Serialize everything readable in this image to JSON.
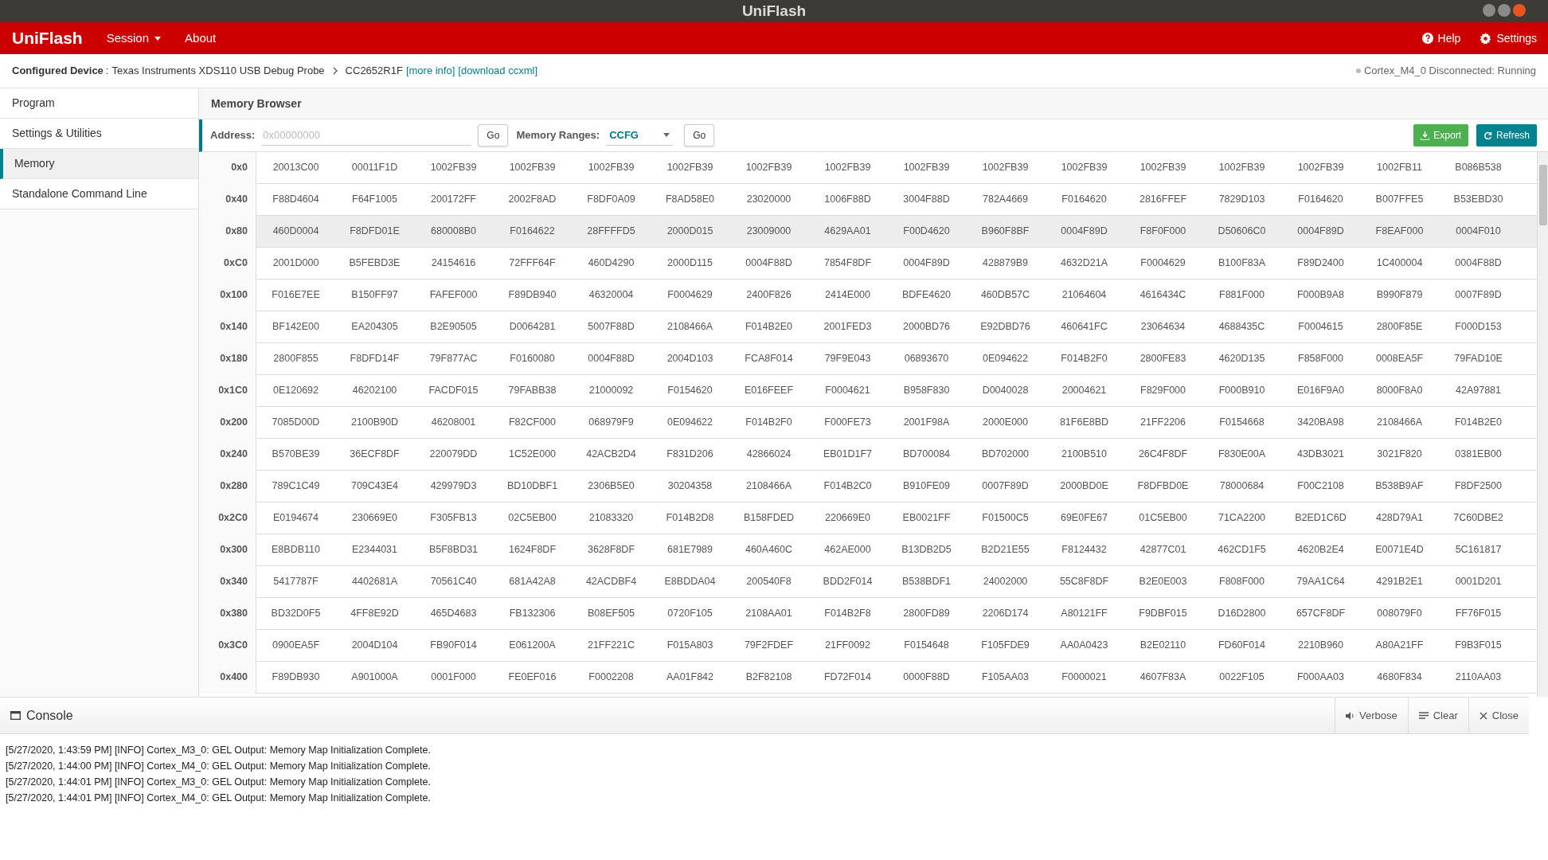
{
  "window": {
    "title": "UniFlash"
  },
  "navbar": {
    "brand": "UniFlash",
    "menus": [
      {
        "label": "Session"
      },
      {
        "label": "About"
      }
    ],
    "actions": [
      {
        "label": "Help"
      },
      {
        "label": "Settings"
      }
    ]
  },
  "breadcrumb": {
    "label": "Configured Device",
    "separator": ":",
    "probe": "Texas Instruments XDS110 USB Debug Probe",
    "device": "CC2652R1F",
    "links": [
      "[more info]",
      "[download ccxml]"
    ],
    "status": "Cortex_M4_0 Disconnected: Running"
  },
  "sidebar": {
    "items": [
      {
        "label": "Program",
        "selected": false
      },
      {
        "label": "Settings & Utilities",
        "selected": false
      },
      {
        "label": "Memory",
        "selected": true
      },
      {
        "label": "Standalone Command Line",
        "selected": false
      }
    ]
  },
  "memory_browser": {
    "title": "Memory Browser",
    "address_label": "Address:",
    "address_placeholder": "0x00000000",
    "go_label": "Go",
    "ranges_label": "Memory Ranges:",
    "range_value": "CCFG",
    "ranges_go_label": "Go",
    "export_label": "Export",
    "refresh_label": "Refresh",
    "rows": [
      {
        "address": "0x0",
        "selected": false,
        "cells": [
          "20013C00",
          "00011F1D",
          "1002FB39",
          "1002FB39",
          "1002FB39",
          "1002FB39",
          "1002FB39",
          "1002FB39",
          "1002FB39",
          "1002FB39",
          "1002FB39",
          "1002FB39",
          "1002FB39",
          "1002FB39",
          "1002FB11",
          "B086B538"
        ]
      },
      {
        "address": "0x40",
        "selected": false,
        "cells": [
          "F88D4604",
          "F64F1005",
          "200172FF",
          "2002F8AD",
          "F8DF0A09",
          "F8AD58E0",
          "23020000",
          "1006F88D",
          "3004F88D",
          "782A4669",
          "F0164620",
          "2816FFEF",
          "7829D103",
          "F0164620",
          "B007FFE5",
          "B53EBD30"
        ]
      },
      {
        "address": "0x80",
        "selected": true,
        "cells": [
          "460D0004",
          "F8DFD01E",
          "680008B0",
          "F0164622",
          "28FFFFD5",
          "2000D015",
          "23009000",
          "4629AA01",
          "F00D4620",
          "B960F8BF",
          "0004F89D",
          "F8F0F000",
          "D50606C0",
          "0004F89D",
          "F8EAF000",
          "0004F010"
        ]
      },
      {
        "address": "0xC0",
        "selected": false,
        "cells": [
          "2001D000",
          "B5FEBD3E",
          "24154616",
          "72FFF64F",
          "460D4290",
          "2000D115",
          "0004F88D",
          "7854F8DF",
          "0004F89D",
          "428879B9",
          "4632D21A",
          "F0004629",
          "B100F83A",
          "F89D2400",
          "1C400004",
          "0004F88D"
        ]
      },
      {
        "address": "0x100",
        "selected": false,
        "cells": [
          "F016E7EE",
          "B150FF97",
          "FAFEF000",
          "F89DB940",
          "46320004",
          "F0004629",
          "2400F826",
          "2414E000",
          "BDFE4620",
          "460DB57C",
          "21064604",
          "4616434C",
          "F881F000",
          "F000B9A8",
          "B990F879",
          "0007F89D"
        ]
      },
      {
        "address": "0x140",
        "selected": false,
        "cells": [
          "BF142E00",
          "EA204305",
          "B2E90505",
          "D0064281",
          "5007F88D",
          "2108466A",
          "F014B2E0",
          "2001FED3",
          "2000BD76",
          "E92DBD76",
          "460641FC",
          "23064634",
          "4688435C",
          "F0004615",
          "2800F85E",
          "F000D153"
        ]
      },
      {
        "address": "0x180",
        "selected": false,
        "cells": [
          "2800F855",
          "F8DFD14F",
          "79F877AC",
          "F0160080",
          "0004F88D",
          "2004D103",
          "FCA8F014",
          "79F9E043",
          "06893670",
          "0E094622",
          "F014B2F0",
          "2800FE83",
          "4620D135",
          "F858F000",
          "0008EA5F",
          "79FAD10E"
        ]
      },
      {
        "address": "0x1C0",
        "selected": false,
        "cells": [
          "0E120692",
          "46202100",
          "FACDF015",
          "79FABB38",
          "21000092",
          "F0154620",
          "E016FEEF",
          "F0004621",
          "B958F830",
          "D0040028",
          "20004621",
          "F829F000",
          "F000B910",
          "E016F9A0",
          "8000F8A0",
          "42A97881"
        ]
      },
      {
        "address": "0x200",
        "selected": false,
        "cells": [
          "7085D00D",
          "2100B90D",
          "46208001",
          "F82CF000",
          "068979F9",
          "0E094622",
          "F014B2F0",
          "F000FE73",
          "2001F98A",
          "2000E000",
          "81F6E8BD",
          "21FF2206",
          "F0154668",
          "3420BA98",
          "2108466A",
          "F014B2E0"
        ]
      },
      {
        "address": "0x240",
        "selected": false,
        "cells": [
          "B570BE39",
          "36ECF8DF",
          "220079DD",
          "1C52E000",
          "42ACB2D4",
          "F831D206",
          "42866024",
          "EB01D1F7",
          "BD700084",
          "BD702000",
          "2100B510",
          "26C4F8DF",
          "F830E00A",
          "43DB3021",
          "3021F820",
          "0381EB00"
        ]
      },
      {
        "address": "0x280",
        "selected": false,
        "cells": [
          "789C1C49",
          "709C43E4",
          "429979D3",
          "BD10DBF1",
          "2306B5E0",
          "30204358",
          "2108466A",
          "F014B2C0",
          "B910FE09",
          "0007F89D",
          "2000BD0E",
          "F8DFBD0E",
          "78000684",
          "F00C2108",
          "B538B9AF",
          "F8DF2500"
        ]
      },
      {
        "address": "0x2C0",
        "selected": false,
        "cells": [
          "E0194674",
          "230669E0",
          "F305FB13",
          "02C5EB00",
          "21083320",
          "F014B2D8",
          "B158FDED",
          "220669E0",
          "EB0021FF",
          "F01500C5",
          "69E0FE67",
          "01C5EB00",
          "71CA2200",
          "B2ED1C6D",
          "428D79A1",
          "7C60DBE2"
        ]
      },
      {
        "address": "0x300",
        "selected": false,
        "cells": [
          "E8BDB110",
          "E2344031",
          "B5F8BD31",
          "1624F8DF",
          "3628F8DF",
          "681E7989",
          "460A460C",
          "462AE000",
          "B13DB2D5",
          "B2D21E55",
          "F8124432",
          "42877C01",
          "462CD1F5",
          "4620B2E4",
          "E0071E4D",
          "5C161817"
        ]
      },
      {
        "address": "0x340",
        "selected": false,
        "cells": [
          "5417787F",
          "4402681A",
          "70561C40",
          "681A42A8",
          "42ACDBF4",
          "E8BDDA04",
          "200540F8",
          "BDD2F014",
          "B538BDF1",
          "24002000",
          "55C8F8DF",
          "B2E0E003",
          "F808F000",
          "79AA1C64",
          "4291B2E1",
          "0001D201"
        ]
      },
      {
        "address": "0x380",
        "selected": false,
        "cells": [
          "BD32D0F5",
          "4FF8E92D",
          "465D4683",
          "FB132306",
          "B08EF505",
          "0720F105",
          "2108AA01",
          "F014B2F8",
          "2800FD89",
          "2206D174",
          "A80121FF",
          "F9DBF015",
          "D16D2800",
          "657CF8DF",
          "008079F0",
          "FF76F015"
        ]
      },
      {
        "address": "0x3C0",
        "selected": false,
        "cells": [
          "0900EA5F",
          "2004D104",
          "FB90F014",
          "E061200A",
          "21FF221C",
          "F015A803",
          "79F2FDEF",
          "21FF0092",
          "F0154648",
          "F105FDE9",
          "AA0A0423",
          "B2E02110",
          "FD60F014",
          "2210B960",
          "A80A21FF",
          "F9B3F015"
        ]
      },
      {
        "address": "0x400",
        "selected": false,
        "cells": [
          "F89DB930",
          "A901000A",
          "0001F000",
          "FE0EF016",
          "F0002208",
          "AA01F842",
          "B2F82108",
          "FD72F014",
          "0000F88D",
          "F105AA03",
          "F0000021",
          "4607F83A",
          "0022F105",
          "F000AA03",
          "4680F834",
          "2110AA03"
        ]
      }
    ]
  },
  "console": {
    "title": "Console",
    "buttons": [
      {
        "label": "Verbose"
      },
      {
        "label": "Clear"
      },
      {
        "label": "Close"
      }
    ],
    "lines": [
      "[5/27/2020, 1:43:59 PM] [INFO] Cortex_M3_0: GEL Output: Memory Map Initialization Complete.",
      "[5/27/2020, 1:44:00 PM] [INFO] Cortex_M4_0: GEL Output: Memory Map Initialization Complete.",
      "[5/27/2020, 1:44:01 PM] [INFO] Cortex_M3_0: GEL Output: Memory Map Initialization Complete.",
      "[5/27/2020, 1:44:01 PM] [INFO] Cortex_M4_0: GEL Output: Memory Map Initialization Complete."
    ]
  }
}
